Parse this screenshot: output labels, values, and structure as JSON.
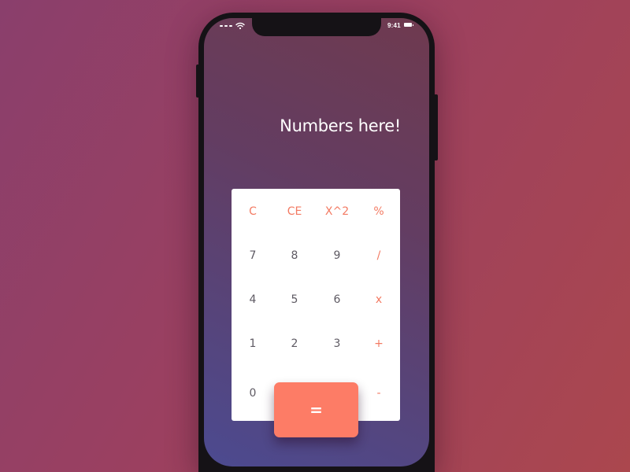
{
  "status_bar": {
    "time": "9:41"
  },
  "display": {
    "text": "Numbers here!"
  },
  "keypad": {
    "rows": [
      [
        "C",
        "CE",
        "X^2",
        "%"
      ],
      [
        "7",
        "8",
        "9",
        "/"
      ],
      [
        "4",
        "5",
        "6",
        "x"
      ],
      [
        "1",
        "2",
        "3",
        "+"
      ],
      [
        "0",
        "",
        "",
        "-"
      ]
    ],
    "equals_label": "="
  },
  "colors": {
    "accent": "#f37a62",
    "equals_button": "#fd7c66",
    "digit_text": "#5e5a63",
    "keypad_background": "#ffffff"
  },
  "icons": {
    "signal": "signal-icon",
    "wifi": "wifi-icon",
    "battery": "battery-icon"
  }
}
